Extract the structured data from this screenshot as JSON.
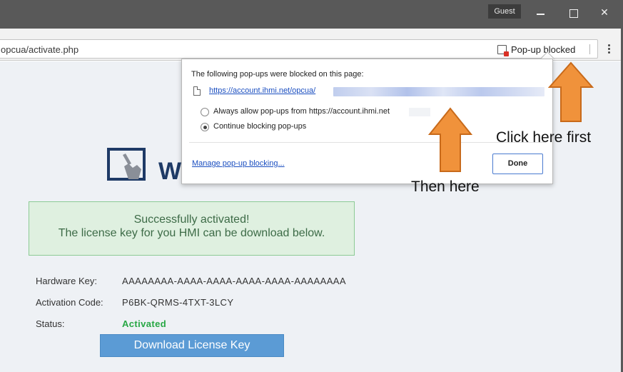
{
  "window": {
    "guest_label": "Guest",
    "minimize_icon": "minimize-icon",
    "maximize_icon": "maximize-icon",
    "close_icon": "close-icon",
    "close_glyph": "✕"
  },
  "toolbar": {
    "url": "opcua/activate.php",
    "popup_blocked_label": "Pop-up blocked",
    "popup_icon": "popup-blocked-icon",
    "menu_icon": "kebab-menu-icon"
  },
  "popup_bubble": {
    "heading": "The following pop-ups were blocked on this page:",
    "blocked_link": "https://account.ihmi.net/opcua/",
    "options": [
      {
        "label": "Always allow pop-ups from https://account.ihmi.net",
        "selected": false
      },
      {
        "label": "Continue blocking pop-ups",
        "selected": true
      }
    ],
    "manage_link": "Manage pop-up blocking...",
    "done_label": "Done"
  },
  "page": {
    "logo_text": "W",
    "success_line1": "Successfully activated!",
    "success_line2": "The license key for you HMI can be download below.",
    "fields": [
      {
        "label": "Hardware Key:",
        "value": "AAAAAAAA-AAAA-AAAA-AAAA-AAAA-AAAAAAAA"
      },
      {
        "label": "Activation Code:",
        "value": "P6BK-QRMS-4TXT-3LCY"
      },
      {
        "label": "Status:",
        "value": "Activated"
      }
    ],
    "download_button": "Download License Key"
  },
  "annotations": {
    "first": "Click here first",
    "second": "Then here"
  },
  "colors": {
    "arrow_fill": "#f0923b",
    "arrow_stroke": "#c86a1a",
    "status_green": "#27a744",
    "button_blue": "#5b9bd5",
    "link_blue": "#1a4ec0"
  }
}
